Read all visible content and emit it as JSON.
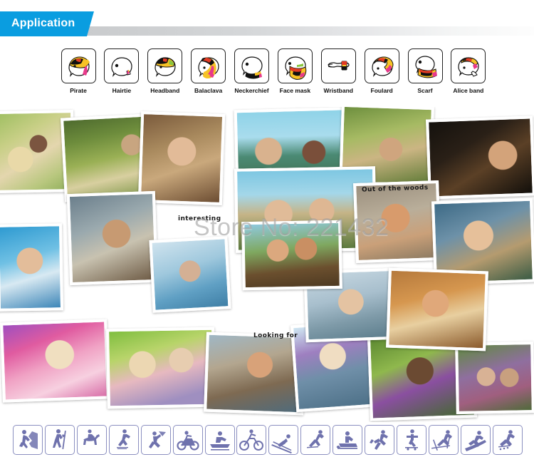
{
  "header": {
    "tab_label": "Application",
    "accent_color": "#0a9de0",
    "band_color": "#c9cbcd"
  },
  "style_icons": {
    "items": [
      {
        "label": "Pirate",
        "icon": "head-pirate-icon"
      },
      {
        "label": "Hairtie",
        "icon": "head-hairtie-icon"
      },
      {
        "label": "Headband",
        "icon": "head-headband-icon"
      },
      {
        "label": "Balaclava",
        "icon": "head-balaclava-icon"
      },
      {
        "label": "Neckerchief",
        "icon": "head-neckerchief-icon"
      },
      {
        "label": "Face mask",
        "icon": "head-facemask-icon"
      },
      {
        "label": "Wristband",
        "icon": "hand-wristband-icon"
      },
      {
        "label": "Foulard",
        "icon": "head-foulard-icon"
      },
      {
        "label": "Scarf",
        "icon": "head-scarf-icon"
      },
      {
        "label": "Alice band",
        "icon": "head-aliceband-icon"
      }
    ]
  },
  "collage": {
    "watermark": "Store No: 221432",
    "captions": [
      {
        "text": "interesting",
        "name": "caption-interesting"
      },
      {
        "text": "Out of the woods",
        "name": "caption-out-of-the-woods"
      },
      {
        "text": "Looking for",
        "name": "caption-looking-for"
      }
    ]
  },
  "sport_icons": {
    "accent_color": "#6f72ad",
    "items": [
      {
        "icon": "climbing-icon"
      },
      {
        "icon": "hiking-icon"
      },
      {
        "icon": "horse-riding-icon"
      },
      {
        "icon": "ice-skating-icon"
      },
      {
        "icon": "kite-surfing-icon"
      },
      {
        "icon": "motorcycling-icon"
      },
      {
        "icon": "rowing-icon"
      },
      {
        "icon": "cycling-icon"
      },
      {
        "icon": "skiing-downhill-icon"
      },
      {
        "icon": "speed-skating-icon"
      },
      {
        "icon": "snowmobiling-icon"
      },
      {
        "icon": "running-icon"
      },
      {
        "icon": "skateboarding-icon"
      },
      {
        "icon": "cross-country-skiing-icon"
      },
      {
        "icon": "snowboarding-icon"
      },
      {
        "icon": "inline-skating-icon"
      }
    ]
  }
}
